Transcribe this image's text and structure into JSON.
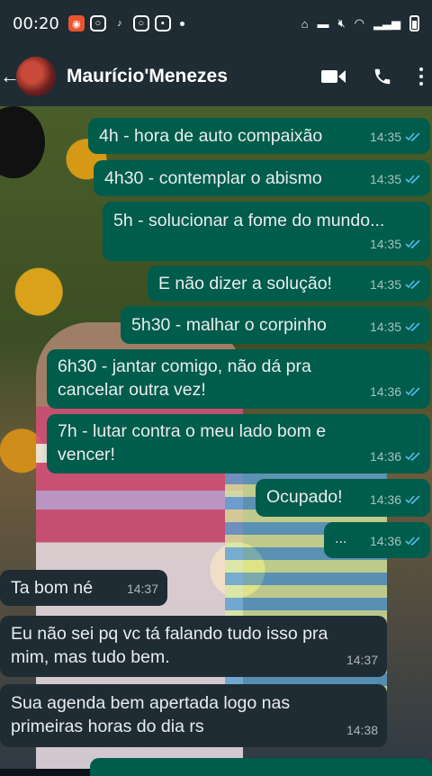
{
  "status_bar": {
    "time": "00:20",
    "notification_icons": [
      "app-notification-icon",
      "instagram-icon",
      "tiktok-icon",
      "instagram-icon",
      "media-icon"
    ],
    "system_icons": [
      "nfc-icon",
      "bed-icon",
      "mute-icon",
      "wifi-icon",
      "signal-icon",
      "battery-icon"
    ]
  },
  "header": {
    "contact_name": "Maurício'Menezes",
    "icons": [
      "back-arrow-icon",
      "video-call-icon",
      "voice-call-icon",
      "more-options-icon"
    ]
  },
  "messages": [
    {
      "dir": "out",
      "text": "4h - hora de auto compaixão",
      "time": "14:35",
      "read": true
    },
    {
      "dir": "out",
      "text": "4h30 - contemplar o abismo",
      "time": "14:35",
      "read": true
    },
    {
      "dir": "out",
      "text": "5h - solucionar a fome do mundo...",
      "time": "14:35",
      "read": true
    },
    {
      "dir": "out",
      "text": "E não dizer a solução!",
      "time": "14:35",
      "read": true
    },
    {
      "dir": "out",
      "text": "5h30 - malhar o corpinho",
      "time": "14:35",
      "read": true
    },
    {
      "dir": "out",
      "text": "6h30 - jantar comigo, não dá pra\ncancelar outra vez!",
      "time": "14:36",
      "read": true
    },
    {
      "dir": "out",
      "text": "7h - lutar contra o meu lado bom e\nvencer!",
      "time": "14:36",
      "read": true
    },
    {
      "dir": "out",
      "text": "Ocupado!",
      "time": "14:36",
      "read": true
    },
    {
      "dir": "out",
      "text": "...",
      "time": "14:36",
      "read": true
    },
    {
      "dir": "in",
      "text": "Ta bom né",
      "time": "14:37"
    },
    {
      "dir": "in",
      "text": "Eu não sei pq vc tá falando tudo isso pra\nmim, mas tudo bem.",
      "time": "14:37"
    },
    {
      "dir": "in",
      "text": "Sua agenda bem apertada logo nas\nprimeiras horas do dia rs",
      "time": "14:38"
    }
  ],
  "colors": {
    "outgoing_bubble": "#005c4b",
    "incoming_bubble": "#1f2c34",
    "header": "#1f2c34",
    "read_ticks": "#53bdeb"
  }
}
